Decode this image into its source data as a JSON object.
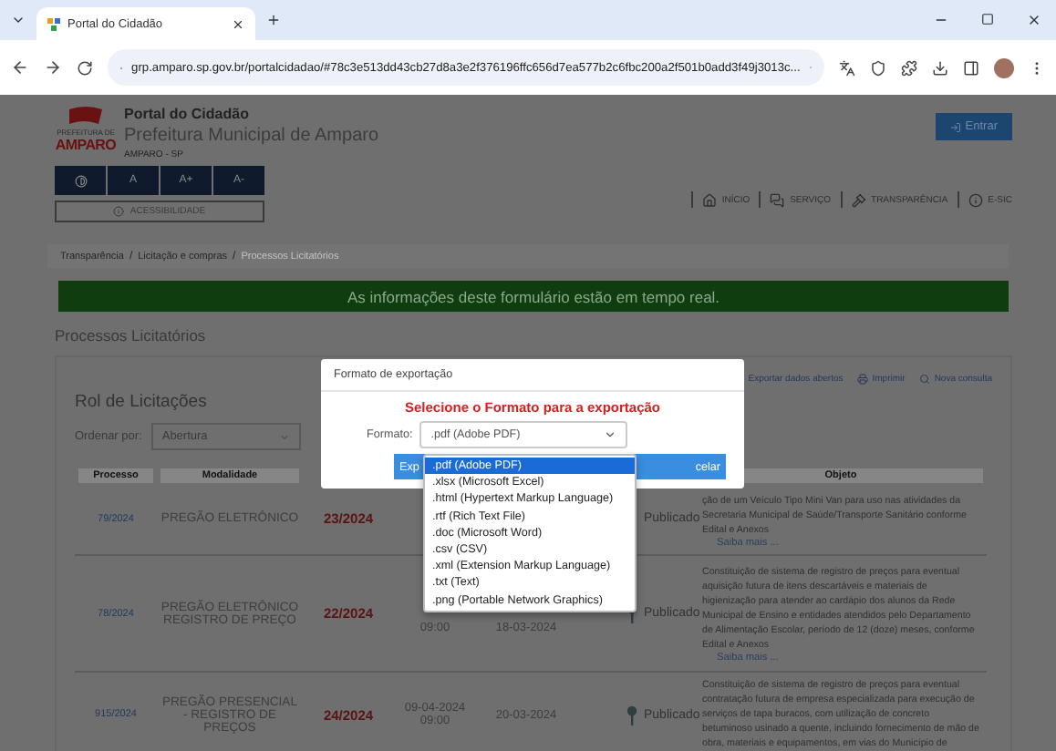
{
  "browser": {
    "tab_title": "Portal do Cidadão",
    "url": "grp.amparo.sp.gov.br/portalcidadao/#78c3e513dd43cb27d8a3e2f376196ffc656d7ea577b2c6fbc200a2f501b0add3f49j3013c..."
  },
  "header": {
    "logo_caption": "PREFEITURA DE",
    "logo_text": "AMPARO",
    "portal_title": "Portal do Cidadão",
    "municipality": "Prefeitura Municipal de Amparo",
    "city": "AMPARO - SP",
    "font_buttons": [
      "A",
      "A+",
      "A-"
    ],
    "accessibility_label": "ACESSIBILIDADE",
    "login_button": "Entrar",
    "nav": [
      {
        "label": "INÍCIO",
        "kind": "home"
      },
      {
        "label": "SERVIÇO",
        "kind": "chat"
      },
      {
        "label": "TRANSPARÊNCIA",
        "kind": "gavel"
      },
      {
        "label": "E-SIC",
        "kind": "info"
      }
    ]
  },
  "breadcrumb_separator": "/",
  "breadcrumb": [
    {
      "label": "Transparência",
      "current": false
    },
    {
      "label": "Licitação e compras",
      "current": false
    },
    {
      "label": "Processos Licitatórios",
      "current": true
    }
  ],
  "banner": "As informações deste formulário estão em tempo real.",
  "page_title": "Processos Licitatórios",
  "card": {
    "title": "Rol de Licitações",
    "actions": [
      {
        "label": "Exportar dados abertos",
        "kind": "export"
      },
      {
        "label": "Imprimir",
        "kind": "print"
      },
      {
        "label": "Nova consulta",
        "kind": "search"
      }
    ],
    "sort_label": "Ordenar por:",
    "sort_value": "Abertura",
    "columns": [
      "Processo",
      "Modalidade",
      "Objeto"
    ],
    "rows": [
      {
        "processo": "79/2024",
        "modalidade": "PREGÃO ELETRÔNICO",
        "numero": "23/2024",
        "abertura": [],
        "publicacao": "",
        "status": "Publicado",
        "objeto": "ção de um Veículo Tipo Mini Van para uso nas atividades da Secretaria Municipal de Saúde/Transporte Sanitário conforme Edital e Anexos",
        "more": "Saiba mais ..."
      },
      {
        "processo": "78/2024",
        "modalidade": "PREGÃO ELETRÔNICO REGISTRO DE PREÇO",
        "numero": "22/2024",
        "abertura": [
          "09:00"
        ],
        "publicacao": "18-03-2024",
        "status": "Publicado",
        "objeto": "Constituição de sistema de registro de preços para eventual aquisição futura de itens descartáveis e materiais de higienização para atender ao cardápio dos alunos da Rede Municipal de Ensino e entidades atendidos pelo Departamento de Alimentação Escolar, período de 12 (doze) meses, conforme Edital e Anexos",
        "more": "Saiba mais ..."
      },
      {
        "processo": "915/2024",
        "modalidade": "PREGÃO PRESENCIAL - REGISTRO DE PREÇOS",
        "numero": "24/2024",
        "abertura": [
          "09-04-2024",
          "09:00"
        ],
        "publicacao": "20-03-2024",
        "status": "Publicado",
        "objeto": "Constituição de sistema de registro de preços para eventual contratação futura de empresa especializada para execução de serviços de tapa buracos, com utilização de concreto betuminoso usinado a quente, incluindo fornecimento de mão de obra, materiais e equipamentos, em vias do Município de",
        "more": ""
      }
    ]
  },
  "modal": {
    "title": "Formato de exportação",
    "heading": "Selecione o Formato para a exportação",
    "field_label": "Formato:",
    "field_value": ".pdf (Adobe PDF)",
    "export_button": "Exp",
    "cancel_button": "celar",
    "options": [
      {
        "label": ".pdf (Adobe PDF)",
        "selected": true
      },
      {
        "label": ".xlsx (Microsoft Excel)",
        "selected": false
      },
      {
        "label": ".html (Hypertext Markup Language)",
        "selected": false
      },
      {
        "label": ".rtf (Rich Text File)",
        "selected": false
      },
      {
        "label": ".doc (Microsoft Word)",
        "selected": false
      },
      {
        "label": ".csv (CSV)",
        "selected": false
      },
      {
        "label": ".xml (Extension Markup Language)",
        "selected": false
      },
      {
        "label": ".txt (Text)",
        "selected": false
      },
      {
        "label": ".png (Portable Network Graphics)",
        "selected": false
      }
    ]
  }
}
